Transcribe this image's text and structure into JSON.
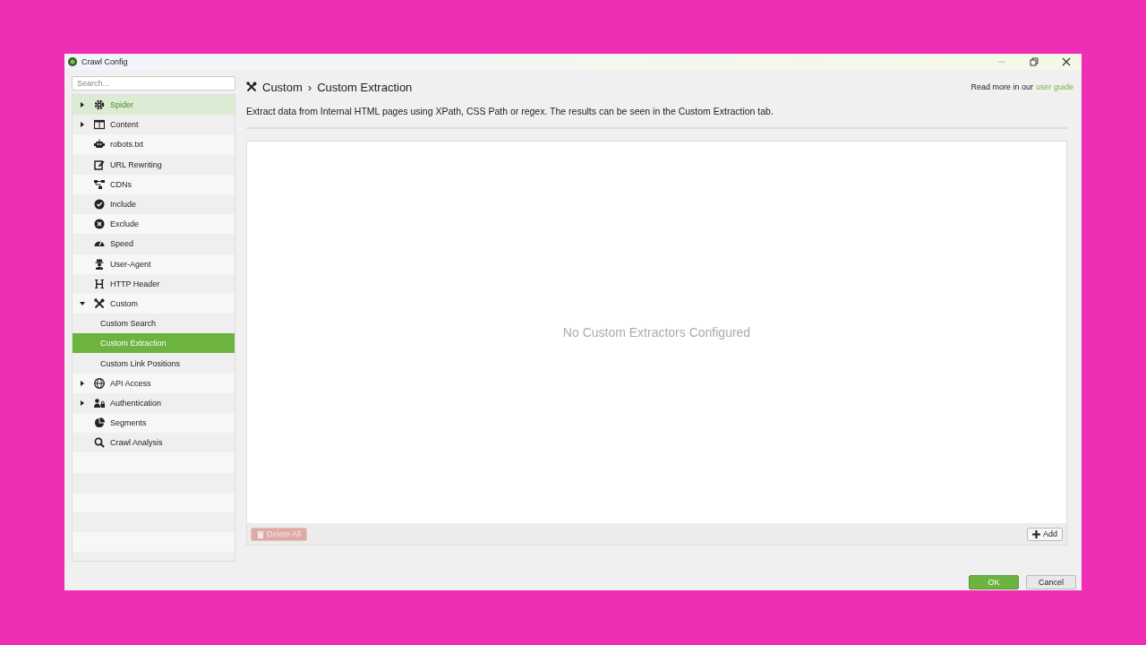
{
  "window": {
    "title": "Crawl Config"
  },
  "sidebar": {
    "search": {
      "placeholder": "Search..."
    },
    "items": [
      {
        "label": "Spider",
        "expanded": false,
        "selected": false,
        "highlighted": true
      },
      {
        "label": "Content",
        "expanded": false,
        "selected": false,
        "highlighted": false
      },
      {
        "label": "robots.txt",
        "selected": false,
        "highlighted": false
      },
      {
        "label": "URL Rewriting",
        "selected": false,
        "highlighted": false
      },
      {
        "label": "CDNs",
        "selected": false,
        "highlighted": false
      },
      {
        "label": "Include",
        "selected": false,
        "highlighted": false
      },
      {
        "label": "Exclude",
        "selected": false,
        "highlighted": false
      },
      {
        "label": "Speed",
        "selected": false,
        "highlighted": false
      },
      {
        "label": "User-Agent",
        "selected": false,
        "highlighted": false
      },
      {
        "label": "HTTP Header",
        "selected": false,
        "highlighted": false
      },
      {
        "label": "Custom",
        "expanded": true,
        "selected": false,
        "highlighted": false,
        "children": [
          {
            "label": "Custom Search",
            "selected": false,
            "highlighted": false
          },
          {
            "label": "Custom Extraction",
            "selected": true,
            "highlighted": false
          },
          {
            "label": "Custom Link Positions",
            "selected": false,
            "highlighted": false
          }
        ]
      },
      {
        "label": "API Access",
        "expanded": false,
        "selected": false,
        "highlighted": false
      },
      {
        "label": "Authentication",
        "expanded": false,
        "selected": false,
        "highlighted": false
      },
      {
        "label": "Segments",
        "selected": false,
        "highlighted": false
      },
      {
        "label": "Crawl Analysis",
        "selected": false,
        "highlighted": false
      }
    ]
  },
  "main": {
    "breadcrumb": [
      "Custom",
      "›",
      "Custom Extraction"
    ],
    "help": {
      "text": "Read more in our",
      "link": "user guide"
    },
    "description": "Extract data from Internal HTML pages using XPath, CSS Path or regex. The results can be seen in the Custom Extraction tab.",
    "empty_message": "No Custom Extractors Configured",
    "delete_button": {
      "label": "Delete All",
      "disabled": true
    },
    "add_button": {
      "label": "Add",
      "disabled": false
    }
  },
  "buttons": [
    {
      "label": "OK",
      "kind": "primary"
    },
    {
      "label": "Cancel",
      "kind": "secondary"
    }
  ]
}
